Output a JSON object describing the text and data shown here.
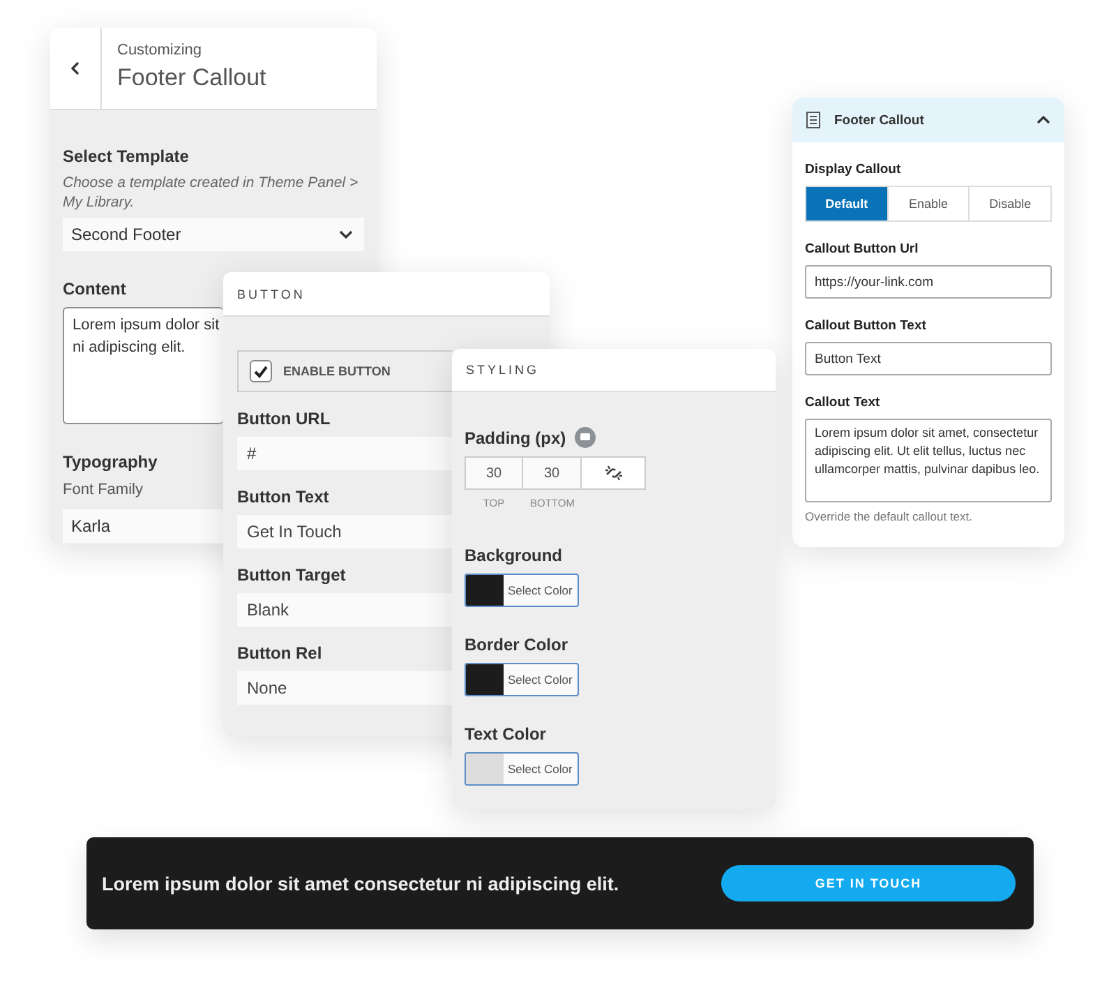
{
  "customizer_panel": {
    "subtitle": "Customizing",
    "title": "Footer Callout",
    "template_label": "Select Template",
    "template_hint": "Choose a template created in Theme Panel > My Library.",
    "template_value": "Second Footer",
    "content_label": "Content",
    "content_lines": [
      "Lorem ipsum dolor sit",
      "ni adipiscing elit."
    ],
    "typography_label": "Typography",
    "font_family_label": "Font Family",
    "font_family_value": "Karla"
  },
  "button_panel": {
    "title": "BUTTON",
    "enable": {
      "label": "ENABLE BUTTON",
      "checked": true
    },
    "fields": [
      {
        "label": "Button URL",
        "value": "#"
      },
      {
        "label": "Button Text",
        "value": "Get In Touch"
      },
      {
        "label": "Button Target",
        "value": "Blank"
      },
      {
        "label": "Button Rel",
        "value": "None"
      }
    ]
  },
  "styling_panel": {
    "title": "STYLING",
    "padding": {
      "label": "Padding (px)",
      "inputs": [
        {
          "value": "30",
          "caption": "TOP"
        },
        {
          "value": "30",
          "caption": "BOTTOM"
        }
      ],
      "linked": false
    },
    "colors": [
      {
        "label": "Background",
        "color": "#1c1c1c",
        "button": "Select Color"
      },
      {
        "label": "Border Color",
        "color": "#1c1c1c",
        "button": "Select Color"
      },
      {
        "label": "Text Color",
        "color": "#dddddd",
        "button": "Select Color"
      }
    ]
  },
  "callout_panel": {
    "title": "Footer Callout",
    "expanded": true,
    "display_label": "Display Callout",
    "options": [
      {
        "label": "Default",
        "selected": true
      },
      {
        "label": "Enable",
        "selected": false
      },
      {
        "label": "Disable",
        "selected": false
      }
    ],
    "fields": [
      {
        "label": "Callout Button Url",
        "value": "https://your-link.com"
      },
      {
        "label": "Callout Button Text",
        "value": "Button Text"
      }
    ],
    "text_label": "Callout Text",
    "text_value": "Lorem ipsum dolor sit amet, consectetur adipiscing elit. Ut elit tellus, luctus nec ullamcorper mattis, pulvinar dapibus leo.",
    "help": "Override the default callout text."
  },
  "footer_preview": {
    "text": "Lorem ipsum dolor sit amet consectetur ni adipiscing elit.",
    "button": "GET IN TOUCH"
  }
}
